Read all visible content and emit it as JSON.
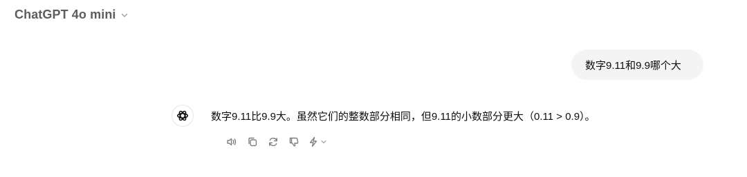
{
  "header": {
    "model_name": "ChatGPT 4o mini"
  },
  "conversation": {
    "user_message": "数字9.11和9.9哪个大",
    "assistant_message": "数字9.11比9.9大。虽然它们的整数部分相同，但9.11的小数部分更大（0.11 > 0.9）。"
  },
  "icons": {
    "model_dropdown": "chevron-down-icon",
    "assistant_avatar": "openai-logo-icon",
    "read_aloud": "speaker-icon",
    "copy": "copy-icon",
    "regenerate": "refresh-icon",
    "thumbs_down": "thumbs-down-icon",
    "switch_model": "sparkle-icon"
  },
  "colors": {
    "model_label": "#5d5d5d",
    "user_bubble": "#f4f4f4",
    "icon_gray": "#7d7d7d"
  }
}
